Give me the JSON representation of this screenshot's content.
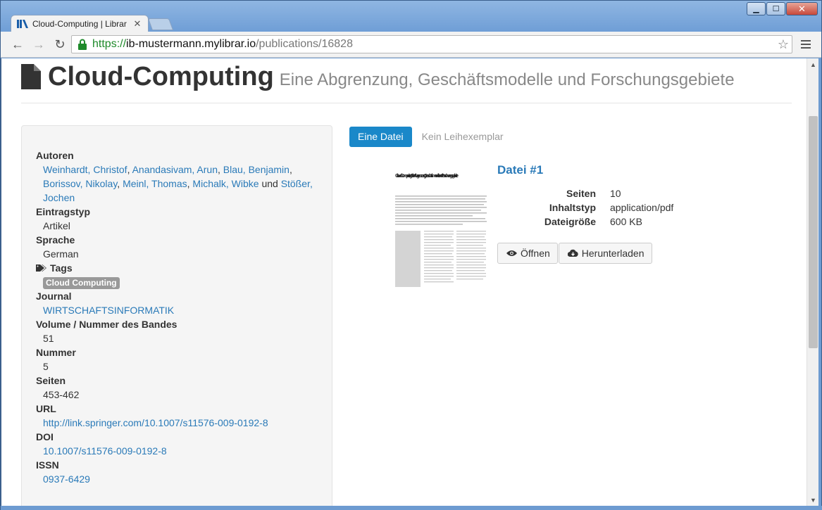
{
  "browser": {
    "tab_title": "Cloud-Computing | Librar",
    "url_scheme": "https://",
    "url_host": "ib-mustermann.mylibrar.io",
    "url_path": "/publications/16828",
    "accent_secure": "#1e8a2a"
  },
  "header": {
    "title": "Cloud-Computing",
    "subtitle": "Eine Abgrenzung, Geschäftsmodelle und Forschungsgebiete"
  },
  "details": {
    "authors_label": "Autoren",
    "authors": [
      "Weinhardt, Christof",
      "Anandasivam, Arun",
      "Blau, Benjamin",
      "Borissov, Nikolay",
      "Meinl, Thomas",
      "Michalk, Wibke"
    ],
    "authors_and": "und",
    "authors_last": "Stößer, Jochen",
    "type_label": "Eintragstyp",
    "type_value": "Artikel",
    "language_label": "Sprache",
    "language_value": "German",
    "tags_label": "Tags",
    "tag": "Cloud Computing",
    "journal_label": "Journal",
    "journal_value": "WIRTSCHAFTSINFORMATIK",
    "volume_label": "Volume / Nummer des Bandes",
    "volume_value": "51",
    "number_label": "Nummer",
    "number_value": "5",
    "pages_label": "Seiten",
    "pages_value": "453-462",
    "url_label": "URL",
    "url_value": "http://link.springer.com/10.1007/s11576-009-0192-8",
    "doi_label": "DOI",
    "doi_value": "10.1007/s11576-009-0192-8",
    "issn_label": "ISSN",
    "issn_value": "0937-6429"
  },
  "tabs": {
    "active": "Eine Datei",
    "inactive": "Kein Leihexemplar"
  },
  "file": {
    "title": "Datei #1",
    "pages_label": "Seiten",
    "pages_value": "10",
    "content_type_label": "Inhaltstyp",
    "content_type_value": "application/pdf",
    "size_label": "Dateigröße",
    "size_value": "600 KB",
    "open_label": "Öffnen",
    "download_label": "Herunterladen",
    "thumb_title": "Cloud-Computing – Eine Abgrenzung, Geschäftsmodelle und Forschungsgebiete"
  }
}
